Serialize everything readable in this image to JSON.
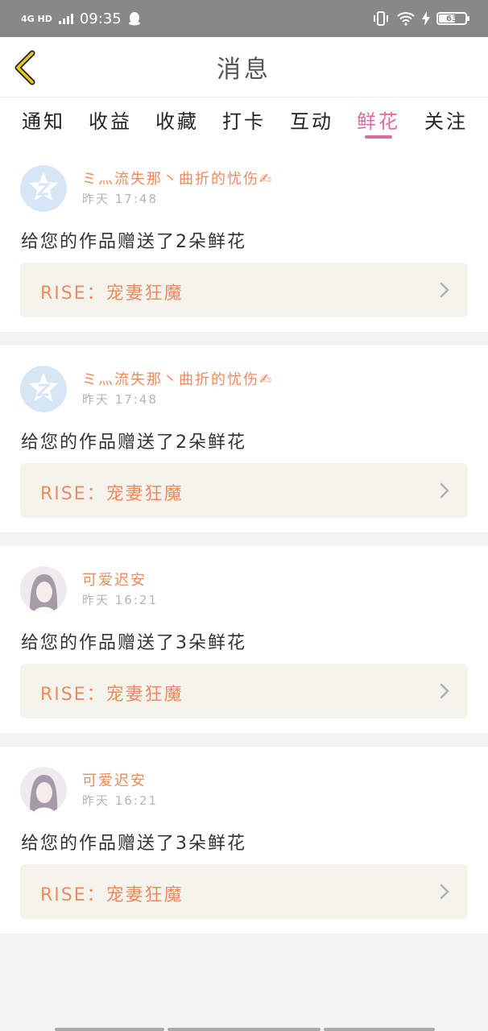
{
  "status_bar": {
    "network": "4G HD",
    "time": "09:35",
    "battery": "63",
    "icons": [
      "signal-icon",
      "qq-icon",
      "vibrate-icon",
      "wifi-icon",
      "charging-icon",
      "battery-icon"
    ]
  },
  "header": {
    "title": "消息",
    "back_icon": "chevron-left-icon"
  },
  "tabs": {
    "items": [
      {
        "label": "通知",
        "active": false
      },
      {
        "label": "收益",
        "active": false
      },
      {
        "label": "收藏",
        "active": false
      },
      {
        "label": "打卡",
        "active": false
      },
      {
        "label": "互动",
        "active": false
      },
      {
        "label": "鲜花",
        "active": true
      },
      {
        "label": "关注",
        "active": false
      }
    ]
  },
  "messages": [
    {
      "username": "ミ灬流失那丶曲折的忧伤✍",
      "time": "昨天  17:48",
      "text": "给您的作品赠送了2朵鲜花",
      "work_title": "RISE：宠妻狂魔",
      "avatar": "default-avatar-icon"
    },
    {
      "username": "ミ灬流失那丶曲折的忧伤✍",
      "time": "昨天  17:48",
      "text": "给您的作品赠送了2朵鲜花",
      "work_title": "RISE：宠妻狂魔",
      "avatar": "default-avatar-icon"
    },
    {
      "username": "可爱迟安",
      "time": "昨天  16:21",
      "text": "给您的作品赠送了3朵鲜花",
      "work_title": "RISE：宠妻狂魔",
      "avatar": "user-photo"
    },
    {
      "username": "可爱迟安",
      "time": "昨天  16:21",
      "text": "给您的作品赠送了3朵鲜花",
      "work_title": "RISE：宠妻狂魔",
      "avatar": "user-photo"
    }
  ],
  "colors": {
    "accent": "#e06aa0",
    "name_orange": "#f08a5d",
    "statusbar": "#888888",
    "work_box": "#f4f4ec",
    "back_arrow": "#e8c820"
  }
}
